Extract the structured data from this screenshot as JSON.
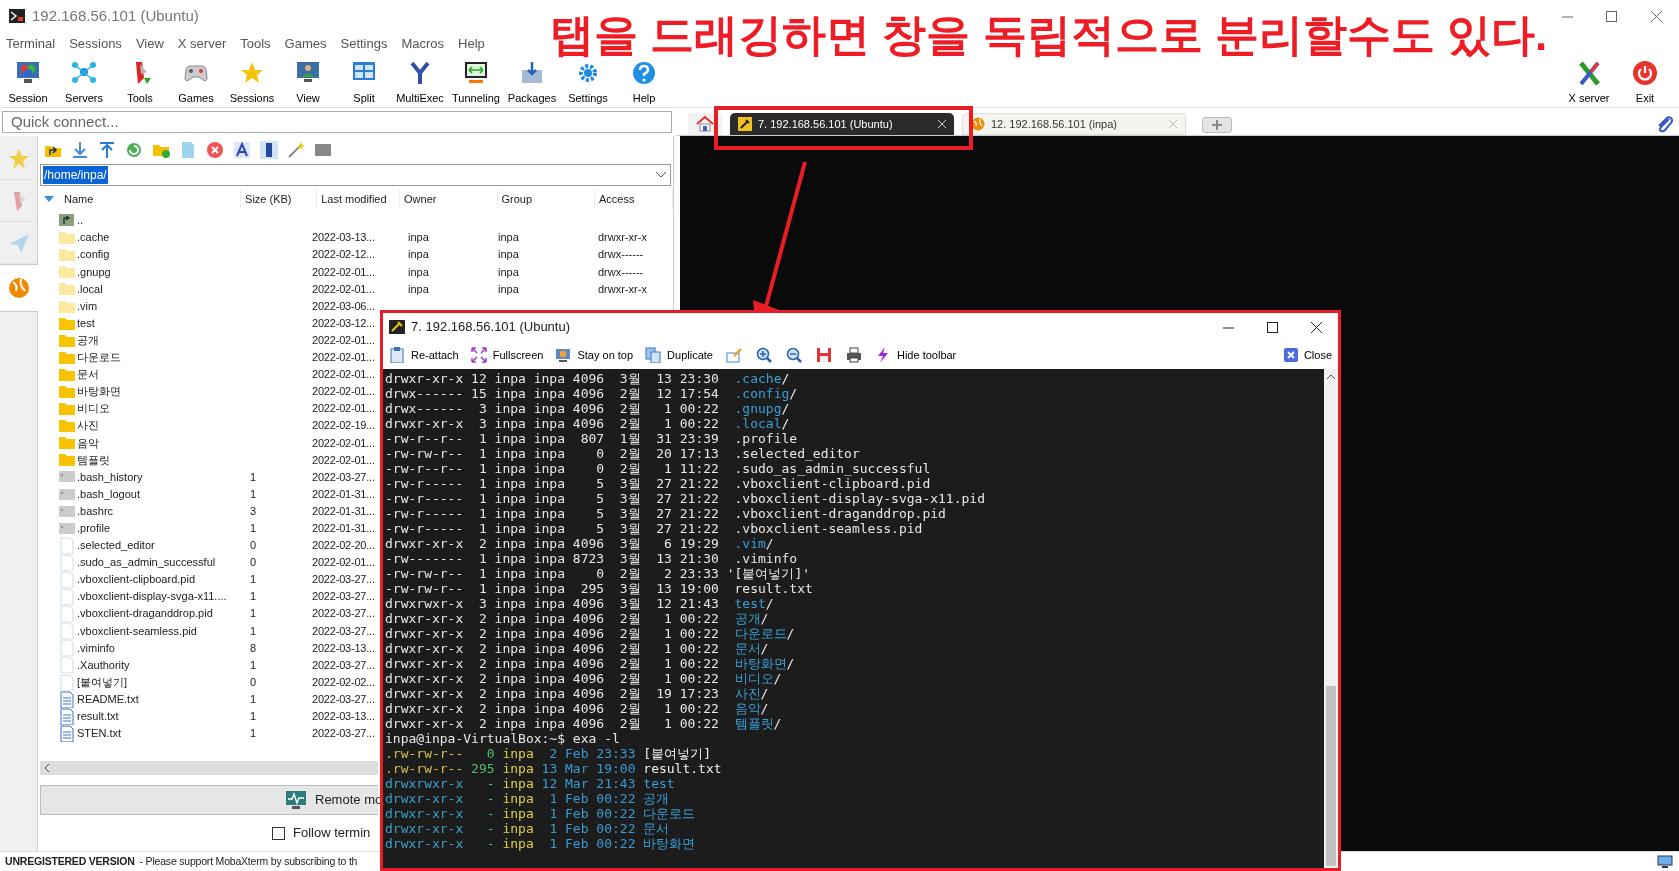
{
  "window": {
    "title": "192.168.56.101 (Ubuntu)"
  },
  "menu": [
    "Terminal",
    "Sessions",
    "View",
    "X server",
    "Tools",
    "Games",
    "Settings",
    "Macros",
    "Help"
  ],
  "toolbar": [
    {
      "label": "Session"
    },
    {
      "label": "Servers"
    },
    {
      "label": "Tools"
    },
    {
      "label": "Games"
    },
    {
      "label": "Sessions"
    },
    {
      "label": "View"
    },
    {
      "label": "Split"
    },
    {
      "label": "MultiExec"
    },
    {
      "label": "Tunneling"
    },
    {
      "label": "Packages"
    },
    {
      "label": "Settings"
    },
    {
      "label": "Help"
    }
  ],
  "toolbar_right": [
    {
      "label": "X server"
    },
    {
      "label": "Exit"
    }
  ],
  "quick_connect": {
    "placeholder": "Quick connect..."
  },
  "side_tabs": [
    {
      "selected": false
    },
    {
      "selected": false
    },
    {
      "selected": false
    },
    {
      "selected": true
    }
  ],
  "tabs": [
    {
      "label": "7. 192.168.56.101 (Ubuntu)",
      "selected": true
    },
    {
      "label": "12. 192.168.56.101 (inpa)",
      "selected": false
    }
  ],
  "annotation": "탭을 드래깅하면 창을 독립적으로 분리할수도 있다.",
  "file_browser": {
    "path": "/home/inpa/",
    "columns": [
      "Name",
      "Size (KB)",
      "Last modified",
      "Owner",
      "Group",
      "Access"
    ],
    "rows": [
      {
        "kind": "parent",
        "name": ".."
      },
      {
        "kind": "hidden-folder",
        "name": ".cache",
        "modified": "2022-03-13...",
        "owner": "inpa",
        "group": "inpa",
        "access": "drwxr-xr-x"
      },
      {
        "kind": "hidden-folder",
        "name": ".config",
        "modified": "2022-02-12...",
        "owner": "inpa",
        "group": "inpa",
        "access": "drwx------"
      },
      {
        "kind": "hidden-folder",
        "name": ".gnupg",
        "modified": "2022-02-01...",
        "owner": "inpa",
        "group": "inpa",
        "access": "drwx------"
      },
      {
        "kind": "hidden-folder",
        "name": ".local",
        "modified": "2022-02-01...",
        "owner": "inpa",
        "group": "inpa",
        "access": "drwxr-xr-x"
      },
      {
        "kind": "hidden-folder",
        "name": ".vim",
        "modified": "2022-03-06..."
      },
      {
        "kind": "folder",
        "name": "test",
        "modified": "2022-03-12..."
      },
      {
        "kind": "folder",
        "name": "공개",
        "modified": "2022-02-01..."
      },
      {
        "kind": "folder",
        "name": "다운로드",
        "modified": "2022-02-01..."
      },
      {
        "kind": "folder",
        "name": "문서",
        "modified": "2022-02-01..."
      },
      {
        "kind": "folder",
        "name": "바탕화면",
        "modified": "2022-02-01..."
      },
      {
        "kind": "folder",
        "name": "비디오",
        "modified": "2022-02-01..."
      },
      {
        "kind": "folder",
        "name": "사진",
        "modified": "2022-02-19..."
      },
      {
        "kind": "folder",
        "name": "음악",
        "modified": "2022-02-01..."
      },
      {
        "kind": "folder",
        "name": "템플릿",
        "modified": "2022-02-01..."
      },
      {
        "kind": "script",
        "name": ".bash_history",
        "size": "1",
        "modified": "2022-03-27..."
      },
      {
        "kind": "script",
        "name": ".bash_logout",
        "size": "1",
        "modified": "2022-01-31..."
      },
      {
        "kind": "script",
        "name": ".bashrc",
        "size": "3",
        "modified": "2022-01-31..."
      },
      {
        "kind": "script",
        "name": ".profile",
        "size": "1",
        "modified": "2022-01-31..."
      },
      {
        "kind": "file",
        "name": ".selected_editor",
        "size": "0",
        "modified": "2022-02-20..."
      },
      {
        "kind": "file",
        "name": ".sudo_as_admin_successful",
        "size": "0",
        "modified": "2022-02-01..."
      },
      {
        "kind": "file",
        "name": ".vboxclient-clipboard.pid",
        "size": "1",
        "modified": "2022-03-27..."
      },
      {
        "kind": "file",
        "name": ".vboxclient-display-svga-x11....",
        "size": "1",
        "modified": "2022-03-27..."
      },
      {
        "kind": "file",
        "name": ".vboxclient-draganddrop.pid",
        "size": "1",
        "modified": "2022-03-27..."
      },
      {
        "kind": "file",
        "name": ".vboxclient-seamless.pid",
        "size": "1",
        "modified": "2022-03-27..."
      },
      {
        "kind": "file",
        "name": ".viminfo",
        "size": "8",
        "modified": "2022-03-13..."
      },
      {
        "kind": "file",
        "name": ".Xauthority",
        "size": "1",
        "modified": "2022-03-27..."
      },
      {
        "kind": "file",
        "name": "[붙여넣기]",
        "size": "0",
        "modified": "2022-02-02..."
      },
      {
        "kind": "text",
        "name": "README.txt",
        "size": "1",
        "modified": "2022-03-27..."
      },
      {
        "kind": "text",
        "name": "result.txt",
        "size": "1",
        "modified": "2022-03-13..."
      },
      {
        "kind": "text",
        "name": "STEN.txt",
        "size": "1",
        "modified": "2022-03-27..."
      }
    ],
    "remote_monitoring": "Remote mo",
    "follow_terminal": {
      "label": "Follow termin",
      "checked": false
    }
  },
  "detached_window": {
    "title": "7. 192.168.56.101 (Ubuntu)",
    "toolbar": [
      {
        "kind": "labeled",
        "label": "Re-attach"
      },
      {
        "kind": "labeled",
        "label": "Fullscreen"
      },
      {
        "kind": "labeled",
        "label": "Stay on top"
      },
      {
        "kind": "labeled",
        "label": "Duplicate"
      },
      {
        "kind": "icon"
      },
      {
        "kind": "icon"
      },
      {
        "kind": "icon"
      },
      {
        "kind": "icon"
      },
      {
        "kind": "icon"
      },
      {
        "kind": "labeled",
        "label": "Hide toolbar"
      }
    ],
    "close": "Close",
    "ls_lines": [
      {
        "kind": "dir",
        "meta": "drwxr-xr-x 12 inpa inpa 4096  3월  13 23:30  ",
        "name": ".cache",
        "suffix": "/"
      },
      {
        "kind": "dir",
        "meta": "drwx------ 15 inpa inpa 4096  2월  12 17:54  ",
        "name": ".config",
        "suffix": "/"
      },
      {
        "kind": "dir",
        "meta": "drwx------  3 inpa inpa 4096  2월   1 00:22  ",
        "name": ".gnupg",
        "suffix": "/"
      },
      {
        "kind": "dir",
        "meta": "drwxr-xr-x  3 inpa inpa 4096  2월   1 00:22  ",
        "name": ".local",
        "suffix": "/"
      },
      {
        "kind": "file",
        "meta": "-rw-r--r--  1 inpa inpa  807  1월  31 23:39  ",
        "name": ".profile"
      },
      {
        "kind": "file",
        "meta": "-rw-rw-r--  1 inpa inpa    0  2월  20 17:13  ",
        "name": ".selected_editor"
      },
      {
        "kind": "file",
        "meta": "-rw-r--r--  1 inpa inpa    0  2월   1 11:22  ",
        "name": ".sudo_as_admin_successful"
      },
      {
        "kind": "file",
        "meta": "-rw-r-----  1 inpa inpa    5  3월  27 21:22  ",
        "name": ".vboxclient-clipboard.pid"
      },
      {
        "kind": "file",
        "meta": "-rw-r-----  1 inpa inpa    5  3월  27 21:22  ",
        "name": ".vboxclient-display-svga-x11.pid"
      },
      {
        "kind": "file",
        "meta": "-rw-r-----  1 inpa inpa    5  3월  27 21:22  ",
        "name": ".vboxclient-draganddrop.pid"
      },
      {
        "kind": "file",
        "meta": "-rw-r-----  1 inpa inpa    5  3월  27 21:22  ",
        "name": ".vboxclient-seamless.pid"
      },
      {
        "kind": "dir",
        "meta": "drwxr-xr-x  2 inpa inpa 4096  3월   6 19:29  ",
        "name": ".vim",
        "suffix": "/"
      },
      {
        "kind": "file",
        "meta": "-rw-------  1 inpa inpa 8723  3월  13 21:30  ",
        "name": ".viminfo"
      },
      {
        "kind": "file",
        "meta": "-rw-rw-r--  1 inpa inpa    0  2월   2 23:33 ",
        "name": "'[붙여넣기]'"
      },
      {
        "kind": "file",
        "meta": "-rw-rw-r--  1 inpa inpa  295  3월  13 19:00  ",
        "name": "result.txt"
      },
      {
        "kind": "dir",
        "meta": "drwxrwxr-x  3 inpa inpa 4096  3월  12 21:43  ",
        "name": "test",
        "suffix": "/"
      },
      {
        "kind": "dir",
        "meta": "drwxr-xr-x  2 inpa inpa 4096  2월   1 00:22  ",
        "name": "공개",
        "suffix": "/"
      },
      {
        "kind": "dir",
        "meta": "drwxr-xr-x  2 inpa inpa 4096  2월   1 00:22  ",
        "name": "다운로드",
        "suffix": "/"
      },
      {
        "kind": "dir",
        "meta": "drwxr-xr-x  2 inpa inpa 4096  2월   1 00:22  ",
        "name": "문서",
        "suffix": "/"
      },
      {
        "kind": "dir",
        "meta": "drwxr-xr-x  2 inpa inpa 4096  2월   1 00:22  ",
        "name": "바탕화면",
        "suffix": "/"
      },
      {
        "kind": "dir",
        "meta": "drwxr-xr-x  2 inpa inpa 4096  2월   1 00:22  ",
        "name": "비디오",
        "suffix": "/"
      },
      {
        "kind": "dir",
        "meta": "drwxr-xr-x  2 inpa inpa 4096  2월  19 17:23  ",
        "name": "사진",
        "suffix": "/"
      },
      {
        "kind": "dir",
        "meta": "drwxr-xr-x  2 inpa inpa 4096  2월   1 00:22  ",
        "name": "음악",
        "suffix": "/"
      },
      {
        "kind": "dir",
        "meta": "drwxr-xr-x  2 inpa inpa 4096  2월   1 00:22  ",
        "name": "템플릿",
        "suffix": "/"
      }
    ],
    "prompt": "inpa@inpa-VirtualBox:~$ exa -l",
    "exa_lines": [
      {
        "kind": "file",
        "perm": ".rw-rw-r--",
        "size": "0",
        "user": "inpa",
        "date": " 2 Feb 23:33",
        "name": "[붙여넣기]"
      },
      {
        "kind": "file",
        "perm": ".rw-rw-r--",
        "size": "295",
        "user": "inpa",
        "date": "13 Mar 19:00",
        "name": "result.txt"
      },
      {
        "kind": "dir",
        "perm": "drwxrwxr-x",
        "size": "-",
        "user": "inpa",
        "date": "12 Mar 21:43",
        "name": "test"
      },
      {
        "kind": "dir",
        "perm": "drwxr-xr-x",
        "size": "-",
        "user": "inpa",
        "date": " 1 Feb 00:22",
        "name": "공개"
      },
      {
        "kind": "dir",
        "perm": "drwxr-xr-x",
        "size": "-",
        "user": "inpa",
        "date": " 1 Feb 00:22",
        "name": "다운로드"
      },
      {
        "kind": "dir",
        "perm": "drwxr-xr-x",
        "size": "-",
        "user": "inpa",
        "date": " 1 Feb 00:22",
        "name": "문서"
      },
      {
        "kind": "dir",
        "perm": "drwxr-xr-x",
        "size": "-",
        "user": "inpa",
        "date": " 1 Feb 00:22",
        "name": "바탕화면"
      }
    ]
  },
  "status_bar": {
    "title": "UNREGISTERED VERSION",
    "message": "-  Please support MobaXterm by subscribing to th"
  }
}
